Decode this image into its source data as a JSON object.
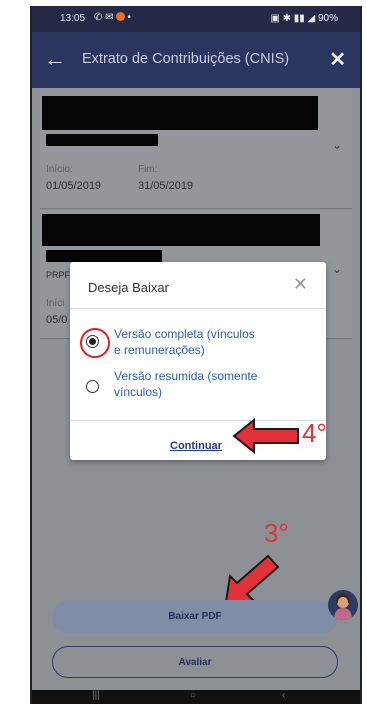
{
  "status_bar": {
    "time": "13:05",
    "right_icons": "90%"
  },
  "app_bar": {
    "title": "Extrato de Contribuições (CNIS)"
  },
  "card1": {
    "inicio_label": "Início:",
    "inicio_value": "01/05/2019",
    "fim_label": "Fim:",
    "fim_value": "31/05/2019"
  },
  "card2": {
    "partial_left": "PRPF",
    "partial_label": "Iníci",
    "partial_value": "05/0"
  },
  "dialog": {
    "title": "Deseja Baixar",
    "options": [
      {
        "line1": "Versão completa (vínculos",
        "line2": "e remunerações)",
        "selected": true
      },
      {
        "line1": "Versão resumida (somente",
        "line2": "vínculos)",
        "selected": false
      }
    ],
    "continue_label": "Continuar"
  },
  "buttons": {
    "pdf_label": "Baixar PDF",
    "rate_label": "Avaliar"
  },
  "annotations": {
    "step4": "4°",
    "step3": "3°"
  },
  "colors": {
    "app_bar": "#2b3560",
    "accent_red": "#d6232b",
    "link_blue": "#2a5fa8"
  }
}
